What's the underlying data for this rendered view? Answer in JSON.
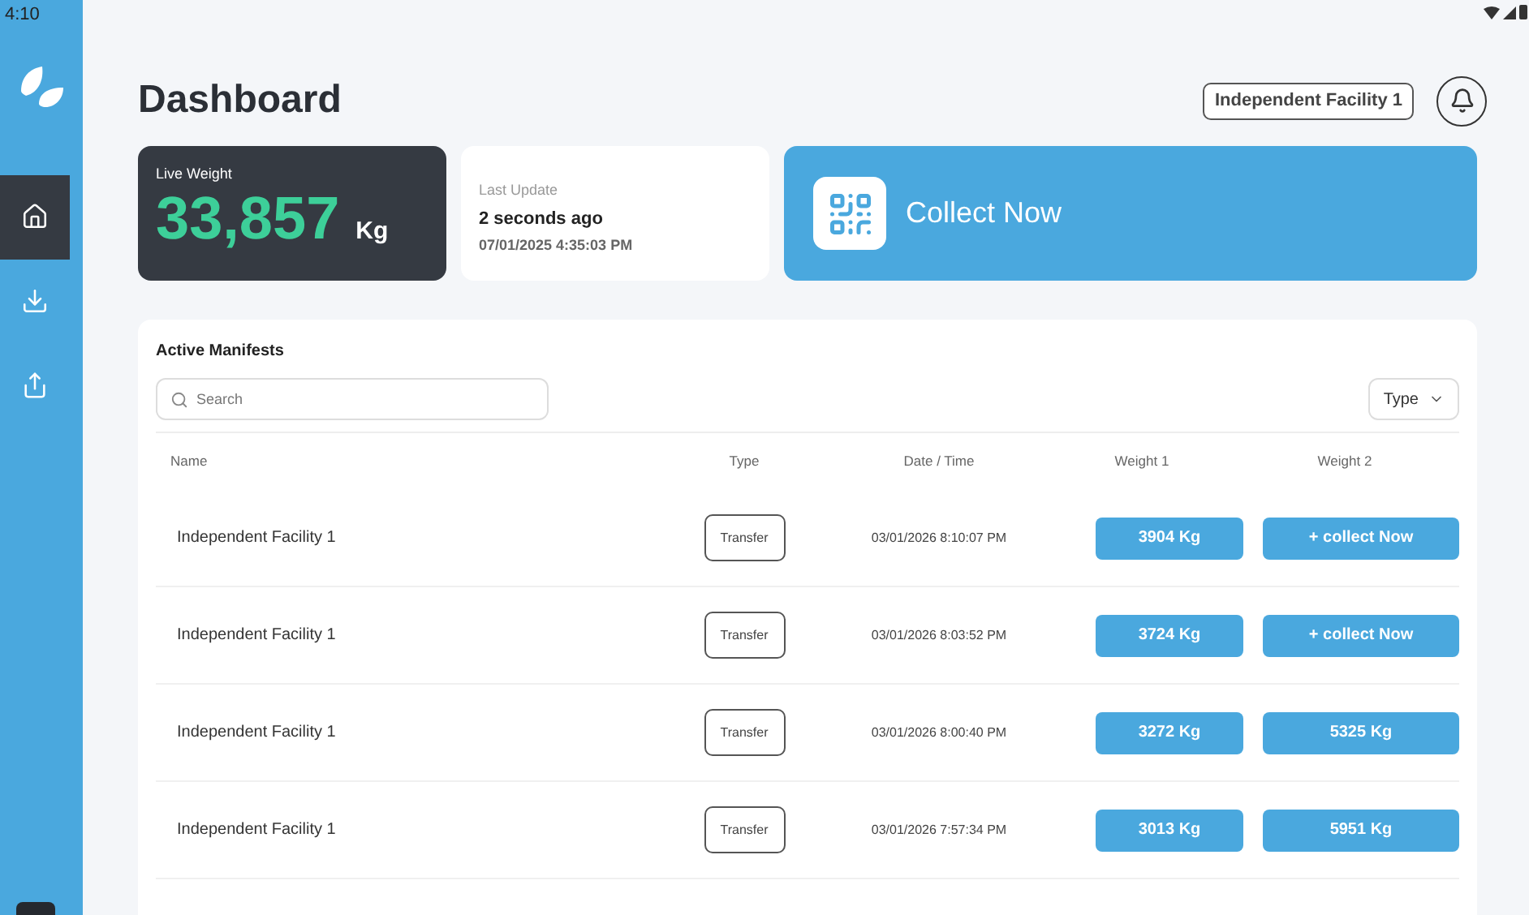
{
  "status_bar": {
    "time": "4:10"
  },
  "sidebar": {
    "items": [
      {
        "kind": "home",
        "selected": true
      },
      {
        "kind": "download",
        "selected": false
      },
      {
        "kind": "upload",
        "selected": false
      }
    ]
  },
  "header": {
    "title": "Dashboard",
    "facility": "Independent Facility 1"
  },
  "live_weight": {
    "label": "Live Weight",
    "value": "33,857",
    "unit": "Kg"
  },
  "last_update": {
    "label": "Last Update",
    "relative": "2 seconds ago",
    "timestamp": "07/01/2025 4:35:03 PM"
  },
  "collect": {
    "label": "Collect Now"
  },
  "manifests": {
    "title": "Active Manifests",
    "search": {
      "placeholder": "Search"
    },
    "type_filter": "Type",
    "columns": [
      "Name",
      "Type",
      "Date / Time",
      "Weight 1",
      "Weight 2"
    ],
    "rows": [
      {
        "name": "Independent Facility 1",
        "type": "Transfer",
        "datetime": "03/01/2026 8:10:07 PM",
        "weight1": "3904 Kg",
        "weight2": "+ collect Now"
      },
      {
        "name": "Independent Facility 1",
        "type": "Transfer",
        "datetime": "03/01/2026 8:03:52 PM",
        "weight1": "3724 Kg",
        "weight2": "+ collect Now"
      },
      {
        "name": "Independent Facility 1",
        "type": "Transfer",
        "datetime": "03/01/2026 8:00:40 PM",
        "weight1": "3272 Kg",
        "weight2": "5325 Kg"
      },
      {
        "name": "Independent Facility 1",
        "type": "Transfer",
        "datetime": "03/01/2026 7:57:34 PM",
        "weight1": "3013 Kg",
        "weight2": "5951 Kg"
      }
    ]
  }
}
